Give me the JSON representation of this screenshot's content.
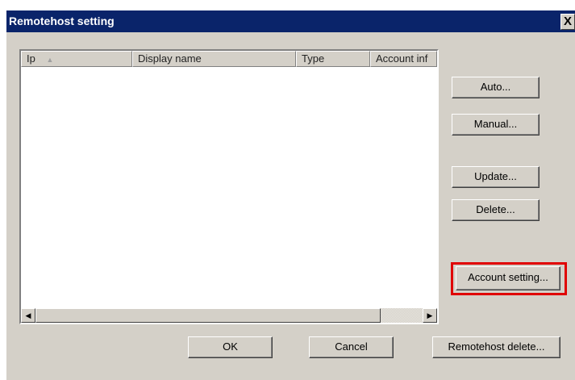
{
  "window": {
    "title": "Remotehost setting",
    "close_glyph": "X"
  },
  "list": {
    "columns": [
      {
        "label": "Ip",
        "sort_indicator": "▲"
      },
      {
        "label": "Display name"
      },
      {
        "label": "Type"
      },
      {
        "label": "Account inf"
      }
    ],
    "rows": []
  },
  "scrollbar": {
    "left_arrow": "◀",
    "right_arrow": "▶"
  },
  "side_buttons": {
    "auto": "Auto...",
    "manual": "Manual...",
    "update": "Update...",
    "delete": "Delete...",
    "account_setting": "Account setting..."
  },
  "bottom_buttons": {
    "ok": "OK",
    "cancel": "Cancel",
    "remotehost_delete": "Remotehost delete..."
  },
  "highlight_color": "#e00000"
}
